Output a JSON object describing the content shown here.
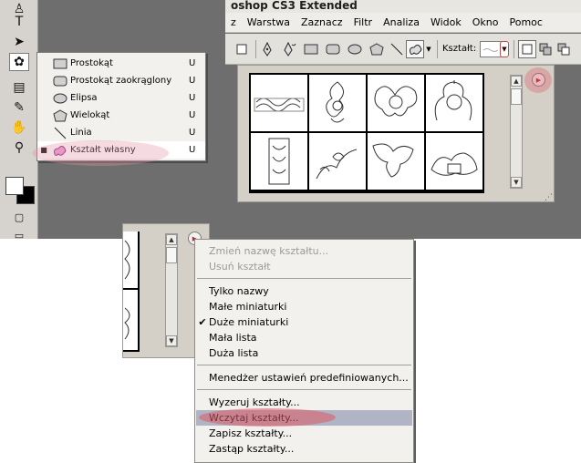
{
  "colors": {
    "menu_highlight": "#b1b4c4",
    "marker": "#dc5a64",
    "workspace": "#6e6e6e",
    "panel": "#d4d0c8"
  },
  "app": {
    "title": "oshop CS3 Extended"
  },
  "menubar": [
    "z",
    "Warstwa",
    "Zaznacz",
    "Filtr",
    "Analiza",
    "Widok",
    "Okno",
    "Pomoc"
  ],
  "toolbox": {
    "tools": [
      {
        "name": "stamp-tool-icon",
        "glyph": "♙"
      },
      {
        "name": "type-tool-icon",
        "glyph": "T"
      },
      {
        "name": "path-selection-tool-icon",
        "glyph": "➤"
      },
      {
        "name": "custom-shape-tool-icon",
        "glyph": "✿"
      },
      {
        "name": "notes-tool-icon",
        "glyph": "▤"
      },
      {
        "name": "eyedropper-tool-icon",
        "glyph": "✎"
      },
      {
        "name": "hand-tool-icon",
        "glyph": "✋"
      },
      {
        "name": "zoom-tool-icon",
        "glyph": "⚲"
      }
    ]
  },
  "shape_flyout": {
    "items": [
      {
        "label": "Prostokąt",
        "key": "U",
        "icon": "rectangle-icon",
        "selected": false
      },
      {
        "label": "Prostokąt zaokrąglony",
        "key": "U",
        "icon": "rounded-rectangle-icon",
        "selected": false
      },
      {
        "label": "Elipsa",
        "key": "U",
        "icon": "ellipse-icon",
        "selected": false
      },
      {
        "label": "Wielokąt",
        "key": "U",
        "icon": "polygon-icon",
        "selected": false
      },
      {
        "label": "Linia",
        "key": "U",
        "icon": "line-icon",
        "selected": false
      },
      {
        "label": "Kształt własny",
        "key": "U",
        "icon": "custom-shape-icon",
        "selected": true
      }
    ]
  },
  "options_bar": {
    "shape_label": "Kształt:"
  },
  "shape_picker": {
    "columns": 4,
    "rows": 2
  },
  "context_menu": {
    "groups": [
      [
        {
          "label": "Zmień nazwę kształtu...",
          "disabled": true
        },
        {
          "label": "Usuń kształt",
          "disabled": true
        }
      ],
      [
        {
          "label": "Tylko nazwy"
        },
        {
          "label": "Małe miniaturki"
        },
        {
          "label": "Duże miniaturki",
          "checked": true
        },
        {
          "label": "Mała lista"
        },
        {
          "label": "Duża lista"
        }
      ],
      [
        {
          "label": "Menedżer ustawień predefiniowanych..."
        }
      ],
      [
        {
          "label": "Wyzeruj kształty..."
        },
        {
          "label": "Wczytaj kształty...",
          "highlighted": true
        },
        {
          "label": "Zapisz kształty..."
        },
        {
          "label": "Zastąp kształty..."
        }
      ]
    ]
  }
}
